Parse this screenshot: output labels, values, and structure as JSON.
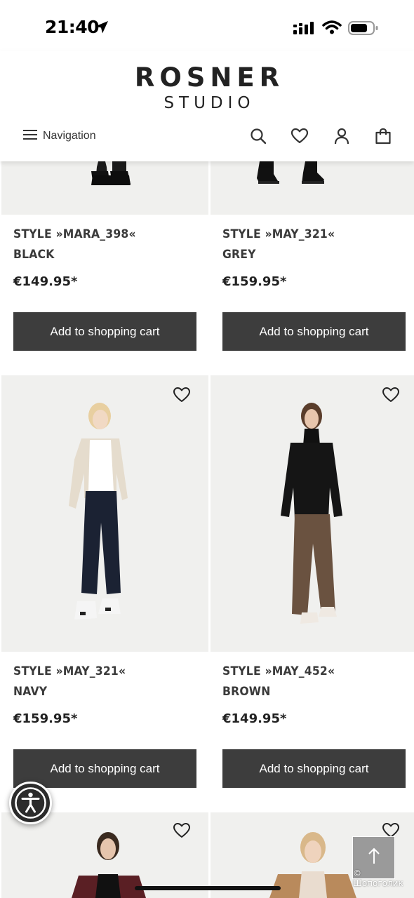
{
  "status_bar": {
    "time": "21:40"
  },
  "brand": {
    "line1": "ROSNER",
    "line2": "STUDIO"
  },
  "header": {
    "navigation_label": "Navigation",
    "icons": [
      "menu-icon",
      "search-icon",
      "heart-icon",
      "user-icon",
      "shopping-bag-icon"
    ]
  },
  "products": [
    {
      "name_line1": "STYLE »MARA_398«",
      "name_line2": "BLACK",
      "price": "€149.95*",
      "cart_label": "Add to shopping cart"
    },
    {
      "name_line1": "STYLE »MAY_321«",
      "name_line2": "GREY",
      "price": "€159.95*",
      "cart_label": "Add to shopping cart"
    },
    {
      "name_line1": "STYLE »MAY_321«",
      "name_line2": "NAVY",
      "price": "€159.95*",
      "cart_label": "Add to shopping cart"
    },
    {
      "name_line1": "STYLE »MAY_452«",
      "name_line2": "BROWN",
      "price": "€149.95*",
      "cart_label": "Add to shopping cart"
    }
  ],
  "watermark": "© Шопоголик",
  "colors": {
    "button_bg": "#3d3d3d",
    "image_bg": "#f0f0ee",
    "text": "#3a3a3a"
  }
}
